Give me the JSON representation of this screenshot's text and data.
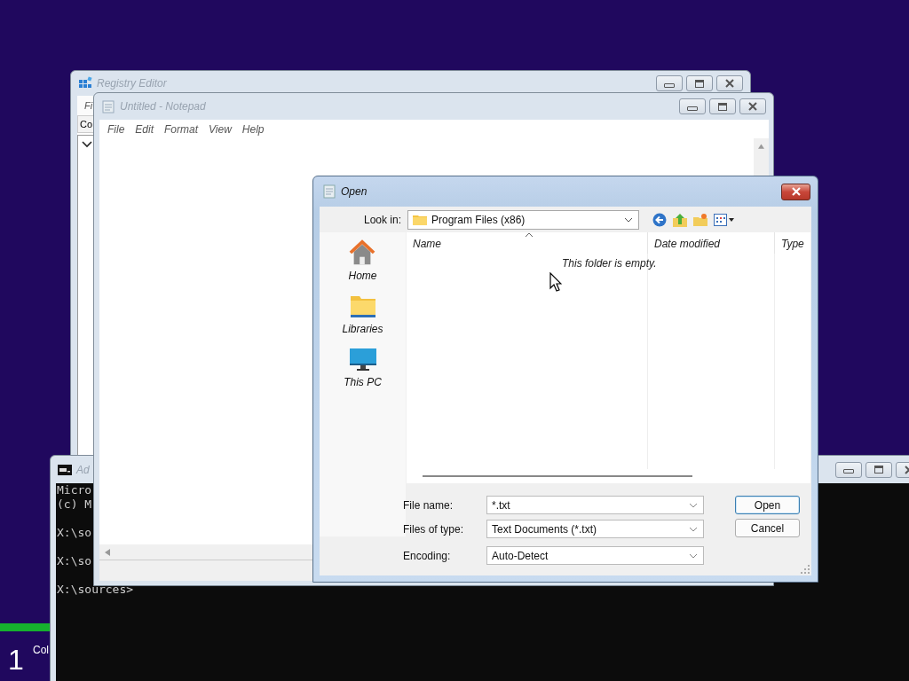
{
  "setup": {
    "progress": {
      "level": 0.1
    },
    "step_number": "1",
    "step_label": "Col"
  },
  "registry_editor": {
    "title": "Registry Editor",
    "active": false,
    "menu": [
      "Fi"
    ],
    "address": "Co"
  },
  "command_prompt": {
    "title": "Ad",
    "active": false,
    "blocks": [
      [
        "Micro",
        "(c) M"
      ],
      [
        "X:\\so"
      ],
      [
        "X:\\so"
      ],
      [
        "X:\\sources>"
      ]
    ]
  },
  "notepad": {
    "title": "Untitled - Notepad",
    "active": false,
    "menu": [
      "File",
      "Edit",
      "Format",
      "View",
      "Help"
    ]
  },
  "open_dialog": {
    "title": "Open",
    "active": true,
    "look_in_label": "Look in:",
    "look_in_value": "Program Files (x86)",
    "places": [
      {
        "label": "Home",
        "kind": "home"
      },
      {
        "label": "Libraries",
        "kind": "libraries"
      },
      {
        "label": "This PC",
        "kind": "pc"
      }
    ],
    "columns": [
      "Name",
      "Date modified",
      "Type"
    ],
    "empty_message": "This folder is empty.",
    "fields": [
      {
        "label": "File name:",
        "value": "*.txt"
      },
      {
        "label": "Files of type:",
        "value": "Text Documents (*.txt)"
      },
      {
        "label": "Encoding:",
        "value": "Auto-Detect"
      }
    ],
    "buttons": [
      {
        "label": "Open",
        "default": true
      },
      {
        "label": "Cancel",
        "default": false
      }
    ]
  }
}
